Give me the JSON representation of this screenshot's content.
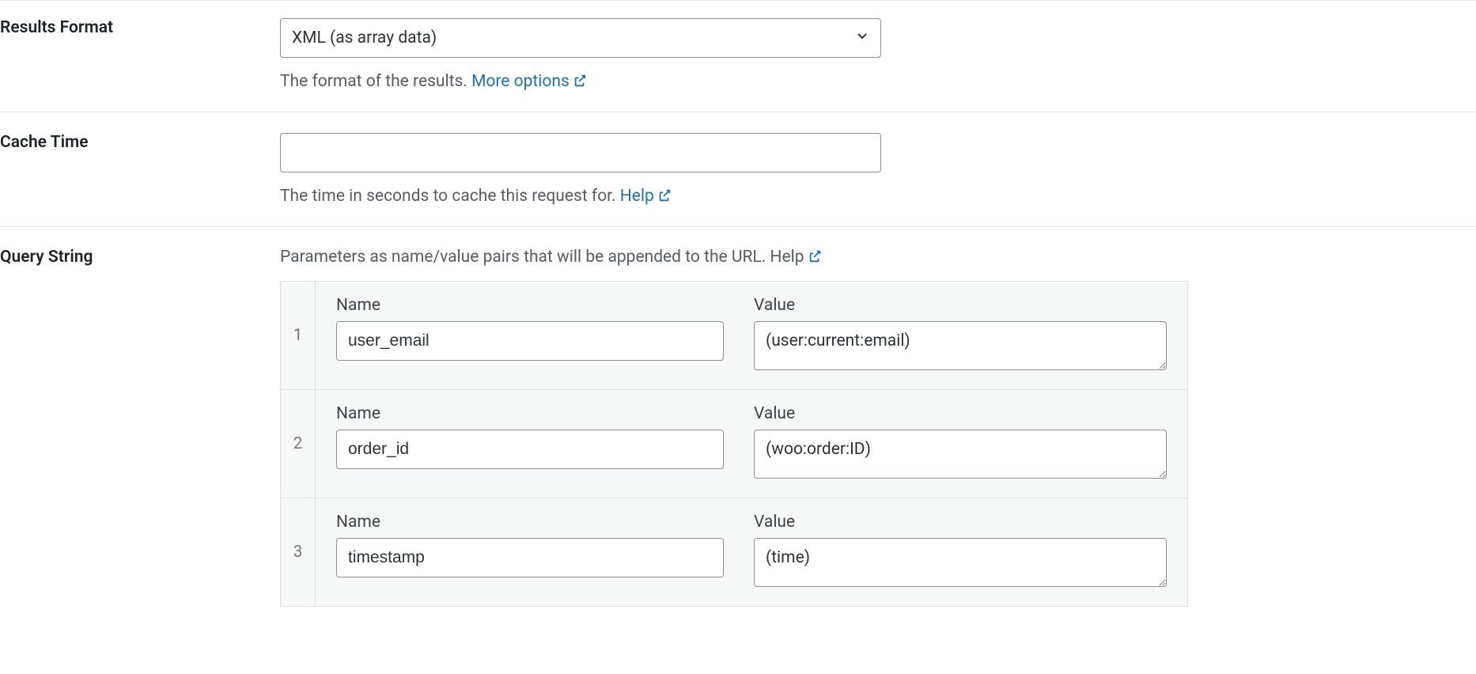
{
  "results_format": {
    "label": "Results Format",
    "selected": "XML (as array data)",
    "description_prefix": "The format of the results. ",
    "link_text": "More options"
  },
  "cache_time": {
    "label": "Cache Time",
    "value": "",
    "description_prefix": "The time in seconds to cache this request for. ",
    "link_text": "Help"
  },
  "query_string": {
    "label": "Query String",
    "description_prefix": "Parameters as name/value pairs that will be appended to the URL. ",
    "link_text": "Help",
    "name_header": "Name",
    "value_header": "Value",
    "rows": [
      {
        "num": "1",
        "name": "user_email",
        "value": "(user:current:email)"
      },
      {
        "num": "2",
        "name": "order_id",
        "value": "(woo:order:ID)"
      },
      {
        "num": "3",
        "name": "timestamp",
        "value": "(time)"
      }
    ]
  }
}
